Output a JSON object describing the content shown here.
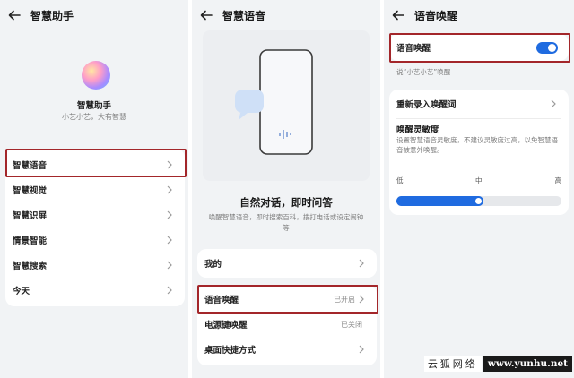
{
  "panel1": {
    "title": "智慧助手",
    "app_name": "智慧助手",
    "tagline": "小艺小艺，大有智慧",
    "items": [
      {
        "label": "智慧语音"
      },
      {
        "label": "智慧视觉"
      },
      {
        "label": "智慧识屏"
      },
      {
        "label": "情景智能"
      },
      {
        "label": "智慧搜索"
      },
      {
        "label": "今天"
      }
    ]
  },
  "panel2": {
    "title": "智慧语音",
    "headline": "自然对话，即时问答",
    "desc": "唤醒智慧语音，即时搜索百科，拨打电话或设定闹钟等",
    "mine": "我的",
    "rows": [
      {
        "label": "语音唤醒",
        "value": "已开启"
      },
      {
        "label": "电源键唤醒",
        "value": "已关闭"
      },
      {
        "label": "桌面快捷方式",
        "value": ""
      }
    ]
  },
  "panel3": {
    "title": "语音唤醒",
    "toggle_label": "语音唤醒",
    "toggle_on": true,
    "hint": "说“小艺小艺”唤醒",
    "rerecord": "重新录入唤醒词",
    "sensitivity_title": "唤醒灵敏度",
    "sensitivity_desc": "设置智慧语音灵敏度，不建议灵敏度过高，以免智慧语音被意外唤醒。",
    "slider_labels": [
      "低",
      "中",
      "高"
    ],
    "slider_value": 0.5
  },
  "watermark": {
    "site_cn": "云狐网络",
    "site_url": "www.yunhu.net"
  },
  "colors": {
    "accent": "#1f6be0",
    "highlight": "#a3262a"
  }
}
